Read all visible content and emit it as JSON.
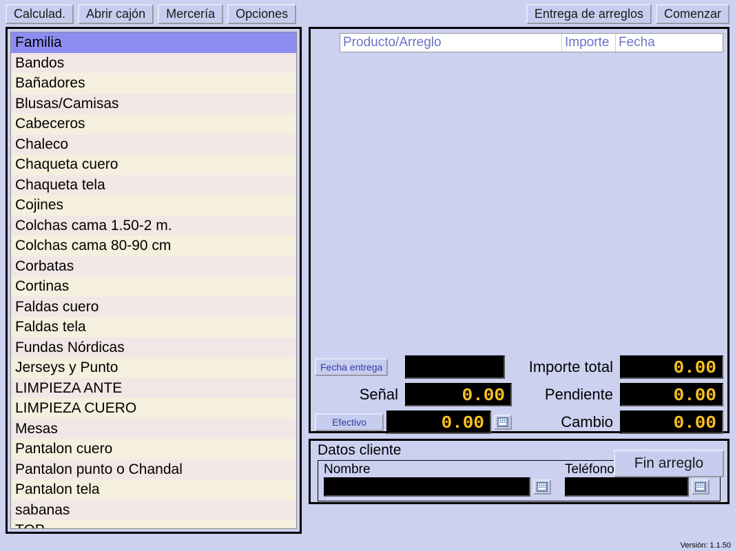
{
  "toolbar": {
    "calc": "Calculad.",
    "open_drawer": "Abrir cajón",
    "merceria": "Mercería",
    "options": "Opciones",
    "delivery": "Entrega de arreglos",
    "start": "Comenzar"
  },
  "families": {
    "header": "Familia",
    "items": [
      "Bandos",
      "Bañadores",
      "Blusas/Camisas",
      "Cabeceros",
      "Chaleco",
      "Chaqueta cuero",
      "Chaqueta tela",
      "Cojines",
      "Colchas cama 1.50-2 m.",
      "Colchas cama 80-90 cm",
      "Corbatas",
      "Cortinas",
      "Faldas cuero",
      "Faldas tela",
      "Fundas Nórdicas",
      "Jerseys y Punto",
      "LIMPIEZA ANTE",
      "LIMPIEZA CUERO",
      "Mesas",
      "Pantalon cuero",
      "Pantalon punto o Chandal",
      "Pantalon tela",
      "sabanas",
      "TOP"
    ]
  },
  "ticket": {
    "columns": {
      "product": "Producto/Arreglo",
      "amount": "Importe",
      "date": "Fecha"
    },
    "rows": []
  },
  "totals": {
    "fecha_entrega_btn": "Fecha entrega",
    "fecha_entrega_val": "",
    "importe_total_label": "Importe total",
    "importe_total_val": "0.00",
    "senal_label": "Señal",
    "senal_val": "0.00",
    "pendiente_label": "Pendiente",
    "pendiente_val": "0.00",
    "efectivo_btn": "Efectivo",
    "efectivo_val": "0.00",
    "cambio_label": "Cambio",
    "cambio_val": "0.00"
  },
  "fin_btn": "Fin arreglo",
  "client": {
    "title": "Datos cliente",
    "name_label": "Nombre",
    "name_val": "",
    "phone_label": "Teléfono",
    "phone_val": ""
  },
  "version": "Versión: 1.1.50"
}
